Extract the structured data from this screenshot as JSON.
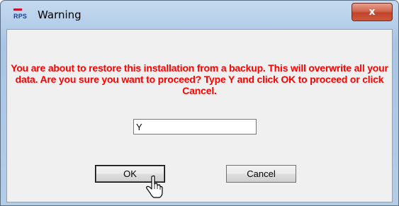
{
  "window": {
    "title": "Warning",
    "icon": "rps-app-icon",
    "icon_text": "RPS",
    "close_label": "x"
  },
  "dialog": {
    "message": "You are about to restore this installation from a backup. This will overwrite all your data. Are you sure you want to proceed? Type Y and click OK to proceed or click Cancel.",
    "message_color": "#ff0000",
    "input_value": "Y",
    "ok_label": "OK",
    "cancel_label": "Cancel"
  }
}
